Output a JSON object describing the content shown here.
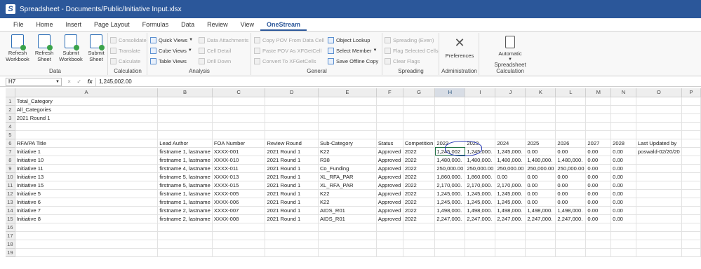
{
  "window": {
    "title": "Spreadsheet - Documents/Public/Initiative Input.xlsx",
    "icon": "onestream-logo-icon"
  },
  "menu": {
    "tabs": [
      "File",
      "Home",
      "Insert",
      "Page Layout",
      "Formulas",
      "Data",
      "Review",
      "View",
      "OneStream"
    ],
    "active_tab": "OneStream"
  },
  "ribbon": {
    "data_group": {
      "label": "Data",
      "buttons": [
        {
          "label_line1": "Refresh",
          "label_line2": "Workbook",
          "icon": "refresh-workbook-icon"
        },
        {
          "label_line1": "Refresh",
          "label_line2": "Sheet",
          "icon": "refresh-sheet-icon"
        },
        {
          "label_line1": "Submit",
          "label_line2": "Workbook",
          "icon": "submit-workbook-icon"
        },
        {
          "label_line1": "Submit",
          "label_line2": "Sheet",
          "icon": "submit-sheet-icon"
        }
      ]
    },
    "calculation_group": {
      "label": "Calculation",
      "items": [
        {
          "label": "Consolidate",
          "enabled": false
        },
        {
          "label": "Translate",
          "enabled": false
        },
        {
          "label": "Calculate",
          "enabled": false
        }
      ]
    },
    "analysis_group": {
      "label": "Analysis",
      "items": [
        {
          "label": "Quick Views",
          "enabled": true,
          "dropdown": true
        },
        {
          "label": "Cube Views",
          "enabled": true,
          "dropdown": true
        },
        {
          "label": "Table Views",
          "enabled": true
        },
        {
          "label": "Data Attachments",
          "enabled": false
        },
        {
          "label": "Cell Detail",
          "enabled": false
        },
        {
          "label": "Drill Down",
          "enabled": false
        }
      ]
    },
    "general_group": {
      "label": "General",
      "items": [
        {
          "label": "Copy POV From Data Cell",
          "enabled": false
        },
        {
          "label": "Paste POV As XFGetCell",
          "enabled": false
        },
        {
          "label": "Convert To XFGetCells",
          "enabled": false
        },
        {
          "label": "Object Lookup",
          "enabled": true
        },
        {
          "label": "Select Member",
          "enabled": true,
          "dropdown": true
        },
        {
          "label": "Save Offline Copy",
          "enabled": true
        }
      ]
    },
    "spreading_group": {
      "label": "Spreading",
      "items": [
        {
          "label": "Spreading (Even)",
          "enabled": false
        },
        {
          "label": "Flag Selected Cells",
          "enabled": false
        },
        {
          "label": "Clear Flags",
          "enabled": false
        }
      ]
    },
    "administration_group": {
      "label": "Administration",
      "button": "Preferences"
    },
    "spreadsheet_calc_group": {
      "label": "Spreadsheet Calculation",
      "button": "Automatic"
    }
  },
  "formula_bar": {
    "cell_ref": "H7",
    "value": "1,245,002.00",
    "cancel": "×",
    "confirm": "✓",
    "fx": "fx"
  },
  "grid": {
    "columns": [
      "A",
      "B",
      "C",
      "D",
      "E",
      "F",
      "G",
      "H",
      "I",
      "J",
      "K",
      "L",
      "M",
      "N",
      "O",
      "P"
    ],
    "selected_column": "H",
    "rows": [
      {
        "n": "1",
        "cells": [
          "Total_Category",
          "",
          "",
          "",
          "",
          "",
          "",
          "",
          "",
          "",
          "",
          "",
          "",
          "",
          "",
          ""
        ]
      },
      {
        "n": "2",
        "cells": [
          "All_Categories",
          "",
          "",
          "",
          "",
          "",
          "",
          "",
          "",
          "",
          "",
          "",
          "",
          "",
          "",
          ""
        ]
      },
      {
        "n": "3",
        "cells": [
          "2021 Round 1",
          "",
          "",
          "",
          "",
          "",
          "",
          "",
          "",
          "",
          "",
          "",
          "",
          "",
          "",
          ""
        ]
      },
      {
        "n": "4",
        "cells": [
          "",
          "",
          "",
          "",
          "",
          "",
          "",
          "",
          "",
          "",
          "",
          "",
          "",
          "",
          "",
          ""
        ]
      },
      {
        "n": "5",
        "cells": [
          "",
          "",
          "",
          "",
          "",
          "",
          "",
          "",
          "",
          "",
          "",
          "",
          "",
          "",
          "",
          ""
        ]
      },
      {
        "n": "6",
        "cells": [
          "RFA/PA Title",
          "Lead Author",
          "FOA Number",
          "Review Round",
          "Sub-Category",
          "Status",
          "Competition",
          "2022",
          "2023",
          "2024",
          "2025",
          "2026",
          "2027",
          "2028",
          "Last Updated by",
          ""
        ]
      },
      {
        "n": "7",
        "cells": [
          "Initiative 1",
          "firstname 1, lastname",
          "XXXX-001",
          "2021 Round 1",
          "K22",
          "Approved",
          "2022",
          "1,245,002",
          "1,245,000.",
          "1,245,000.",
          "0.00",
          "0.00",
          "0.00",
          "0.00",
          "poswald-02/20/20",
          ""
        ]
      },
      {
        "n": "8",
        "cells": [
          "Initiative 10",
          "firstname 1, lastname",
          "XXXX-010",
          "2021 Round 1",
          "R38",
          "Approved",
          "2022",
          "1,480,000.",
          "1,480,000.",
          "1,480,000.",
          "1,480,000.",
          "1,480,000.",
          "0.00",
          "0.00",
          "",
          ""
        ]
      },
      {
        "n": "9",
        "cells": [
          "Initiative 11",
          "firstname 4, lastname",
          "XXXX-011",
          "2021 Round 1",
          "Co_Funding",
          "Approved",
          "2022",
          "250,000.00",
          "250,000.00",
          "250,000.00",
          "250,000.00",
          "250,000.00",
          "0.00",
          "0.00",
          "",
          ""
        ]
      },
      {
        "n": "10",
        "cells": [
          "Initiative 13",
          "firstname 5, lastname",
          "XXXX-013",
          "2021 Round 1",
          "XL_RFA_PAR",
          "Approved",
          "2022",
          "1,860,000.",
          "1,860,000.",
          "0.00",
          "0.00",
          "0.00",
          "0.00",
          "0.00",
          "",
          ""
        ]
      },
      {
        "n": "11",
        "cells": [
          "Initiative 15",
          "firstname 5, lastname",
          "XXXX-015",
          "2021 Round 1",
          "XL_RFA_PAR",
          "Approved",
          "2022",
          "2,170,000.",
          "2,170,000.",
          "2,170,000.",
          "0.00",
          "0.00",
          "0.00",
          "0.00",
          "",
          ""
        ]
      },
      {
        "n": "12",
        "cells": [
          "Initiative 5",
          "firstname 1, lastname",
          "XXXX-005",
          "2021 Round 1",
          "K22",
          "Approved",
          "2022",
          "1,245,000.",
          "1,245,000.",
          "1,245,000.",
          "0.00",
          "0.00",
          "0.00",
          "0.00",
          "",
          ""
        ]
      },
      {
        "n": "13",
        "cells": [
          "Initiative 6",
          "firstname 1, lastname",
          "XXXX-006",
          "2021 Round 1",
          "K22",
          "Approved",
          "2022",
          "1,245,000.",
          "1,245,000.",
          "1,245,000.",
          "0.00",
          "0.00",
          "0.00",
          "0.00",
          "",
          ""
        ]
      },
      {
        "n": "14",
        "cells": [
          "Initiative 7",
          "firstname 2, lastname",
          "XXXX-007",
          "2021 Round 1",
          "AIDS_R01",
          "Approved",
          "2022",
          "1,498,000.",
          "1,498,000.",
          "1,498,000.",
          "1,498,000.",
          "1,498,000.",
          "0.00",
          "0.00",
          "",
          ""
        ]
      },
      {
        "n": "15",
        "cells": [
          "Initiative 8",
          "firstname 2, lastname",
          "XXXX-008",
          "2021 Round 1",
          "AIDS_R01",
          "Approved",
          "2022",
          "2,247,000.",
          "2,247,000.",
          "2,247,000.",
          "2,247,000.",
          "2,247,000.",
          "0.00",
          "0.00",
          "",
          ""
        ]
      },
      {
        "n": "16",
        "cells": [
          "",
          "",
          "",
          "",
          "",
          "",
          "",
          "",
          "",
          "",
          "",
          "",
          "",
          "",
          "",
          ""
        ]
      },
      {
        "n": "17",
        "cells": [
          "",
          "",
          "",
          "",
          "",
          "",
          "",
          "",
          "",
          "",
          "",
          "",
          "",
          "",
          "",
          ""
        ]
      },
      {
        "n": "18",
        "cells": [
          "",
          "",
          "",
          "",
          "",
          "",
          "",
          "",
          "",
          "",
          "",
          "",
          "",
          "",
          "",
          ""
        ]
      },
      {
        "n": "19",
        "cells": [
          "",
          "",
          "",
          "",
          "",
          "",
          "",
          "",
          "",
          "",
          "",
          "",
          "",
          "",
          "",
          ""
        ]
      }
    ],
    "active_cell": {
      "row": "7",
      "column": "H"
    },
    "annotation": "hand-drawn-circle-around-2022"
  },
  "colors": {
    "titlebar": "#2b579a",
    "accent": "#2b579a",
    "annotation": "#2a3bb5",
    "active_cell": "#217346"
  }
}
